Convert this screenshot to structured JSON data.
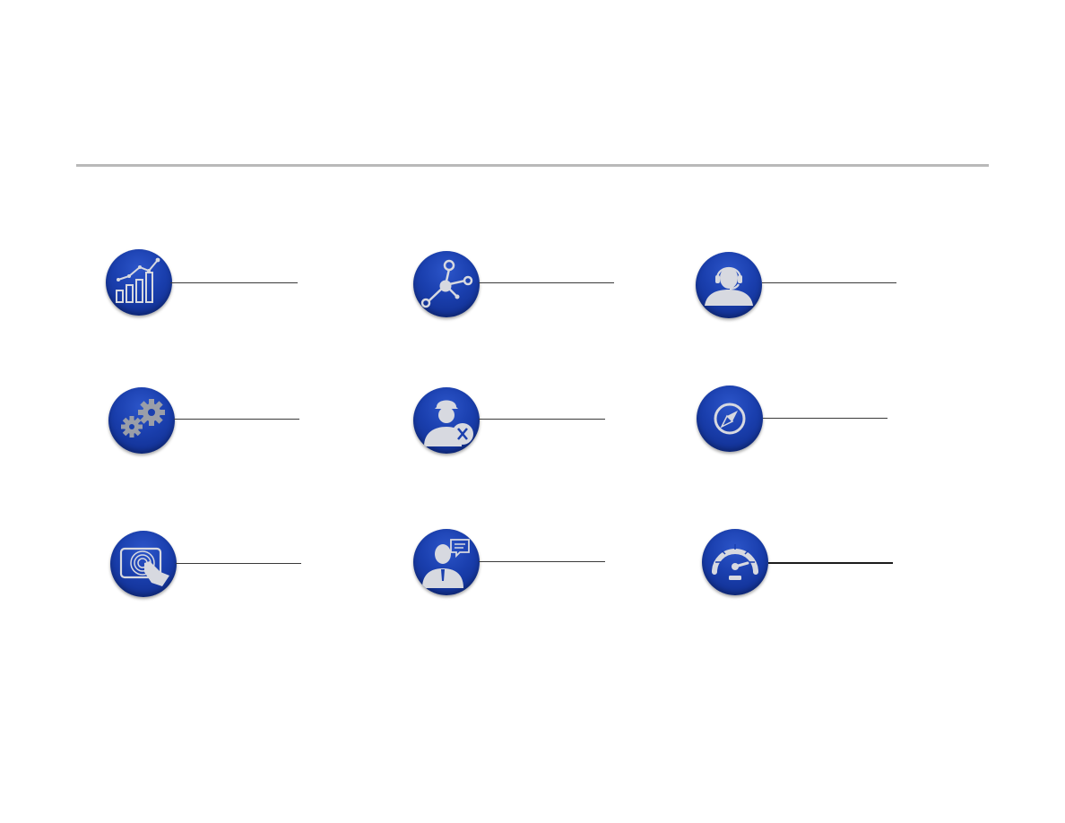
{
  "slide": {
    "items": [
      {
        "icon": "bar-chart-trend-icon"
      },
      {
        "icon": "network-nodes-icon"
      },
      {
        "icon": "headset-support-agent-icon"
      },
      {
        "icon": "gears-icon"
      },
      {
        "icon": "engineer-with-tools-icon"
      },
      {
        "icon": "compass-icon"
      },
      {
        "icon": "touch-tablet-icon"
      },
      {
        "icon": "consultant-speech-icon"
      },
      {
        "icon": "speedometer-icon"
      }
    ]
  },
  "colors": {
    "badge": "#1a3fae",
    "icon_fill": "#c9ccd6",
    "divider": "#b9b9b9",
    "leader": "#3a3a3a"
  }
}
